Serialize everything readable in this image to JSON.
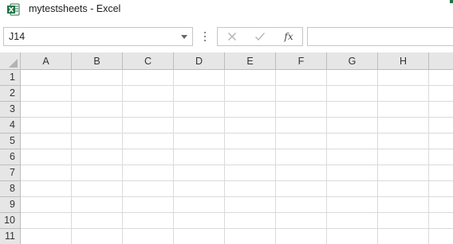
{
  "window": {
    "title": "mytestsheets - Excel",
    "app_icon": "excel-logo",
    "accent_color": "#217346"
  },
  "formula_bar": {
    "name_box_value": "J14",
    "cancel_icon": "close-icon",
    "enter_icon": "checkmark-icon",
    "function_label": "fx",
    "formula_value": ""
  },
  "sheet": {
    "columns": [
      "A",
      "B",
      "C",
      "D",
      "E",
      "F",
      "G",
      "H"
    ],
    "rows": [
      "1",
      "2",
      "3",
      "4",
      "5",
      "6",
      "7",
      "8",
      "9",
      "10",
      "11"
    ]
  }
}
